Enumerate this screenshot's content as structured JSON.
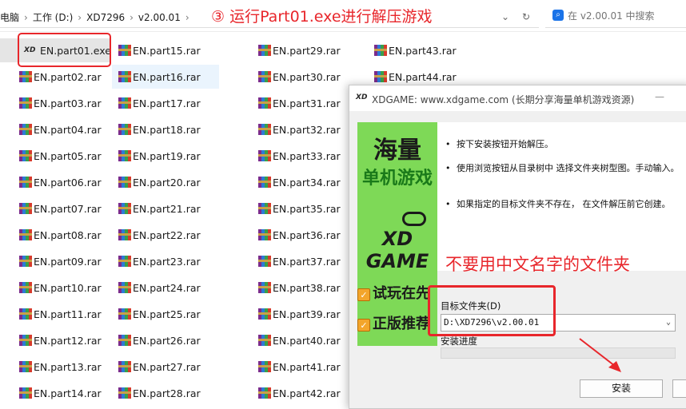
{
  "breadcrumb": [
    "电脑",
    "工作 (D:)",
    "XD7296",
    "v2.00.01"
  ],
  "annotations": {
    "step": "③ 运行Part01.exe进行解压游戏",
    "warning": "不要用中文名字的文件夹"
  },
  "search": {
    "placeholder": "在 v2.00.01 中搜索"
  },
  "files": {
    "col1": [
      "EN.part01.exe",
      "EN.part02.rar",
      "EN.part03.rar",
      "EN.part04.rar",
      "EN.part05.rar",
      "EN.part06.rar",
      "EN.part07.rar",
      "EN.part08.rar",
      "EN.part09.rar",
      "EN.part10.rar",
      "EN.part11.rar",
      "EN.part12.rar",
      "EN.part13.rar",
      "EN.part14.rar"
    ],
    "col2": [
      "EN.part15.rar",
      "EN.part16.rar",
      "EN.part17.rar",
      "EN.part18.rar",
      "EN.part19.rar",
      "EN.part20.rar",
      "EN.part21.rar",
      "EN.part22.rar",
      "EN.part23.rar",
      "EN.part24.rar",
      "EN.part25.rar",
      "EN.part26.rar",
      "EN.part27.rar",
      "EN.part28.rar"
    ],
    "col3": [
      "EN.part29.rar",
      "EN.part30.rar",
      "EN.part31.rar",
      "EN.part32.rar",
      "EN.part33.rar",
      "EN.part34.rar",
      "EN.part35.rar",
      "EN.part36.rar",
      "EN.part37.rar",
      "EN.part38.rar",
      "EN.part39.rar",
      "EN.part40.rar",
      "EN.part41.rar",
      "EN.part42.rar"
    ],
    "col4": [
      "EN.part43.rar",
      "EN.part44.rar"
    ]
  },
  "dialog": {
    "title": "XDGAME: www.xdgame.com (长期分享海量单机游戏资源)",
    "logo": "XD",
    "banner": {
      "line1": "海量",
      "line2": "单机游戏",
      "line3": "XD GAME",
      "line4": "试玩在先",
      "line5": "正版推荐"
    },
    "bullets": [
      "按下安装按钮开始解压。",
      "使用浏览按钮从目录树中 选择文件夹树型图。手动输入。",
      "如果指定的目标文件夹不存在， 在文件解压前它创建。"
    ],
    "target_label": "目标文件夹(D)",
    "target_value": "D:\\XD7296\\v2.00.01",
    "progress_label": "安装进度",
    "progress": 0,
    "install_label": "安装"
  }
}
